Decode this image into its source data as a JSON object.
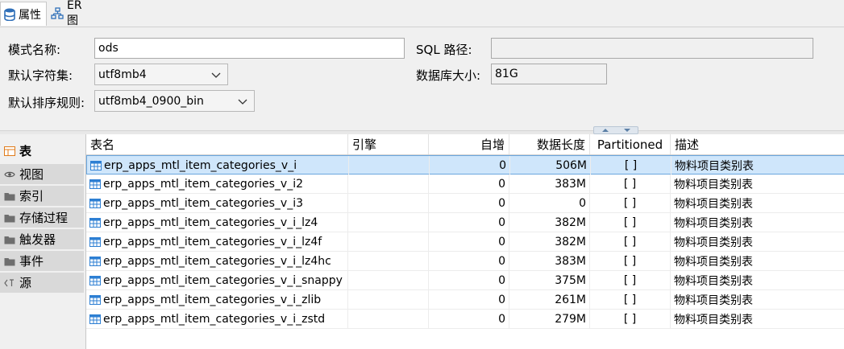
{
  "tabs": [
    {
      "label": "属性",
      "icon": "database-icon"
    },
    {
      "label": "ER 图",
      "icon": "er-diagram-icon"
    }
  ],
  "props": {
    "schema_name_label": "模式名称:",
    "schema_name_value": "ods",
    "charset_label": "默认字符集:",
    "charset_value": "utf8mb4",
    "collation_label": "默认排序规则:",
    "collation_value": "utf8mb4_0900_bin",
    "sql_path_label": "SQL 路径:",
    "sql_path_value": "",
    "db_size_label": "数据库大小:",
    "db_size_value": "81G"
  },
  "sidebar": [
    {
      "label": "表",
      "icon": "table-icon"
    },
    {
      "label": "视图",
      "icon": "eye-icon"
    },
    {
      "label": "索引",
      "icon": "folder-icon"
    },
    {
      "label": "存储过程",
      "icon": "folder-icon"
    },
    {
      "label": "触发器",
      "icon": "folder-icon"
    },
    {
      "label": "事件",
      "icon": "folder-icon"
    },
    {
      "label": "源",
      "icon": "source-icon"
    }
  ],
  "table": {
    "columns": [
      "表名",
      "引擎",
      "自增",
      "数据长度",
      "Partitioned",
      "描述"
    ],
    "rows": [
      {
        "name": "erp_apps_mtl_item_categories_v_i",
        "engine": "",
        "auto_inc": "0",
        "data_length": "506M",
        "partitioned": "[ ]",
        "desc": "物料项目类别表"
      },
      {
        "name": "erp_apps_mtl_item_categories_v_i2",
        "engine": "",
        "auto_inc": "0",
        "data_length": "383M",
        "partitioned": "[ ]",
        "desc": "物料项目类别表"
      },
      {
        "name": "erp_apps_mtl_item_categories_v_i3",
        "engine": "",
        "auto_inc": "0",
        "data_length": "0",
        "partitioned": "[ ]",
        "desc": "物料项目类别表"
      },
      {
        "name": "erp_apps_mtl_item_categories_v_i_lz4",
        "engine": "",
        "auto_inc": "0",
        "data_length": "382M",
        "partitioned": "[ ]",
        "desc": "物料项目类别表"
      },
      {
        "name": "erp_apps_mtl_item_categories_v_i_lz4f",
        "engine": "",
        "auto_inc": "0",
        "data_length": "382M",
        "partitioned": "[ ]",
        "desc": "物料项目类别表"
      },
      {
        "name": "erp_apps_mtl_item_categories_v_i_lz4hc",
        "engine": "",
        "auto_inc": "0",
        "data_length": "383M",
        "partitioned": "[ ]",
        "desc": "物料项目类别表"
      },
      {
        "name": "erp_apps_mtl_item_categories_v_i_snappy",
        "engine": "",
        "auto_inc": "0",
        "data_length": "375M",
        "partitioned": "[ ]",
        "desc": "物料项目类别表"
      },
      {
        "name": "erp_apps_mtl_item_categories_v_i_zlib",
        "engine": "",
        "auto_inc": "0",
        "data_length": "261M",
        "partitioned": "[ ]",
        "desc": "物料项目类别表"
      },
      {
        "name": "erp_apps_mtl_item_categories_v_i_zstd",
        "engine": "",
        "auto_inc": "0",
        "data_length": "279M",
        "partitioned": "[ ]",
        "desc": "物料项目类别表"
      }
    ]
  },
  "colors": {
    "accent": "#2f6fb8",
    "selected_row": "#cfe6fb",
    "table_icon": "#2d7fd3",
    "folder_icon": "#6e6e6e"
  }
}
